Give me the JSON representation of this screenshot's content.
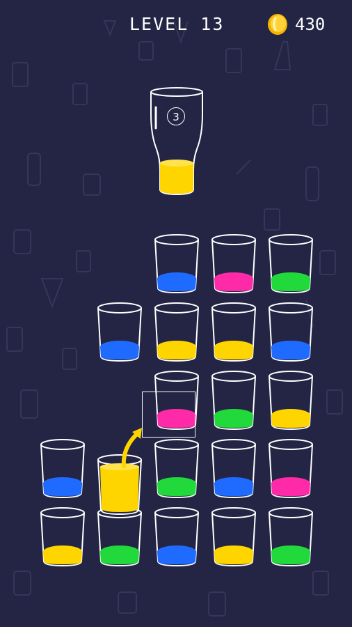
{
  "hud": {
    "level_label": "LEVEL 13",
    "coins": "430",
    "coin_icon": "gold-coin-icon"
  },
  "target": {
    "moves_left": "3",
    "liquid_color": "#ffd500"
  },
  "colors": {
    "background": "#242544",
    "blue": "#1f6bff",
    "pink": "#ff2aa8",
    "green": "#21d93a",
    "yellow": "#ffd500"
  },
  "grid": {
    "rows": [
      {
        "row": 1,
        "cups": [
          null,
          null,
          "blue",
          "pink",
          "green"
        ]
      },
      {
        "row": 2,
        "cups": [
          null,
          "blue",
          "yellow",
          "yellow",
          "blue"
        ]
      },
      {
        "row": 3,
        "cups": [
          null,
          null,
          "pink",
          "green",
          "yellow"
        ]
      },
      {
        "row": 4,
        "cups": [
          "blue",
          "yellow-full-pouring",
          "green",
          "blue",
          "pink"
        ]
      },
      {
        "row": 5,
        "cups": [
          "yellow",
          "green",
          "blue",
          "yellow",
          "green"
        ]
      }
    ]
  }
}
